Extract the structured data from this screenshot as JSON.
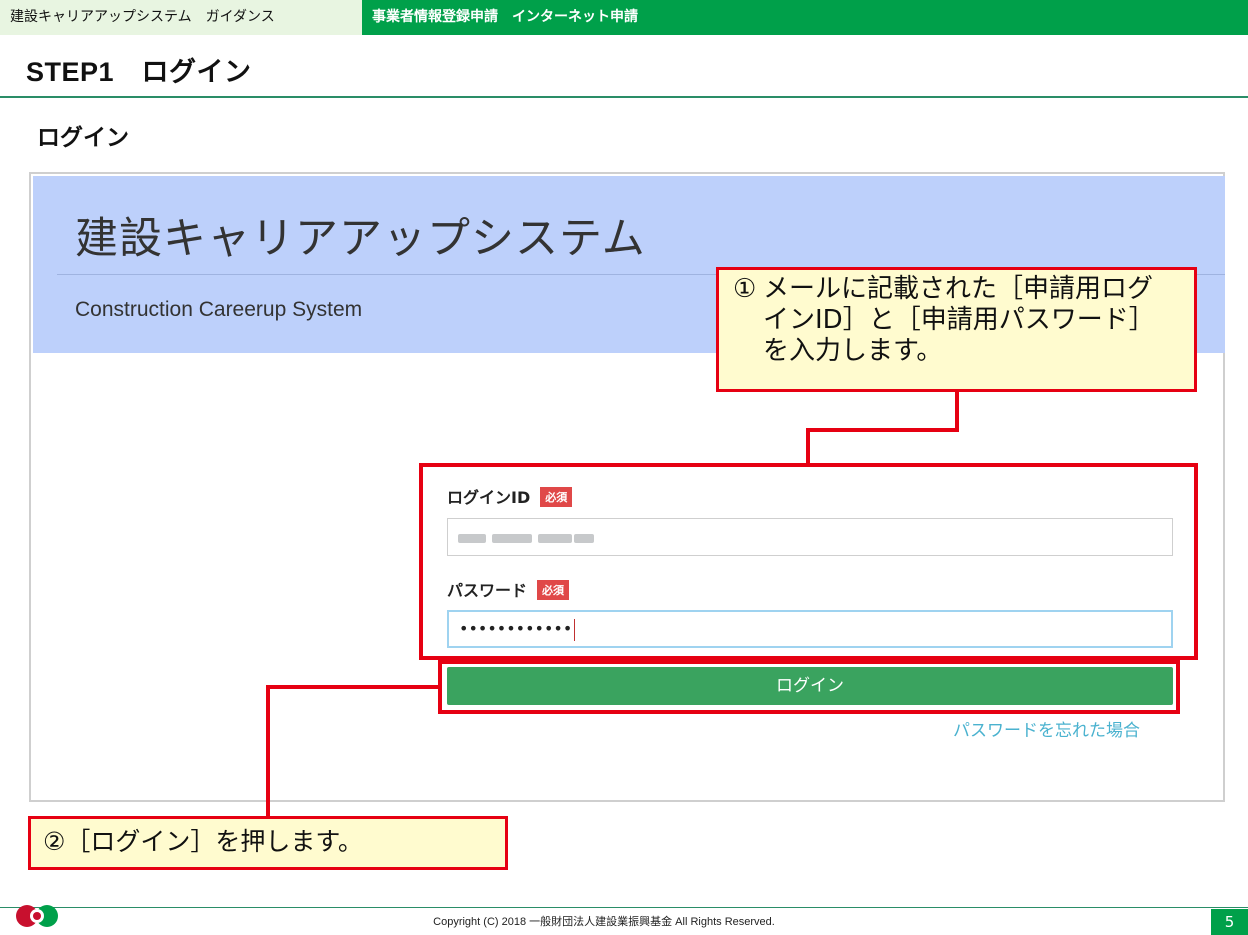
{
  "header": {
    "guide_label": "建設キャリアアップシステム　ガイダンス",
    "section_label": "事業者情報登録申請　インターネット申請"
  },
  "step_title": "STEP1　ログイン",
  "sub_heading": "ログイン",
  "screenshot": {
    "system_name_ja": "建設キャリアアップシステム",
    "system_name_en": "Construction Careerup System",
    "login_id_label": "ログインID",
    "password_label": "パスワード",
    "required_badge": "必須",
    "password_value": "••••••••••••",
    "login_button": "ログイン",
    "forgot_password": "パスワードを忘れた場合"
  },
  "callouts": {
    "callout1_number": "①",
    "callout1_text": "メールに記載された［申請用ログインID］と［申請用パスワード］を入力します。",
    "callout2_text": "②［ログイン］を押します。"
  },
  "footer": {
    "copyright": "Copyright (C) 2018 一般財団法人建設業振興基金 All Rights Reserved.",
    "page_number": "5"
  },
  "colors": {
    "brand_green": "#00a04a",
    "banner_blue": "#bdd0fb",
    "annotation_red": "#e60012",
    "callout_yellow": "#fffbcf",
    "login_green": "#3aa35f"
  }
}
